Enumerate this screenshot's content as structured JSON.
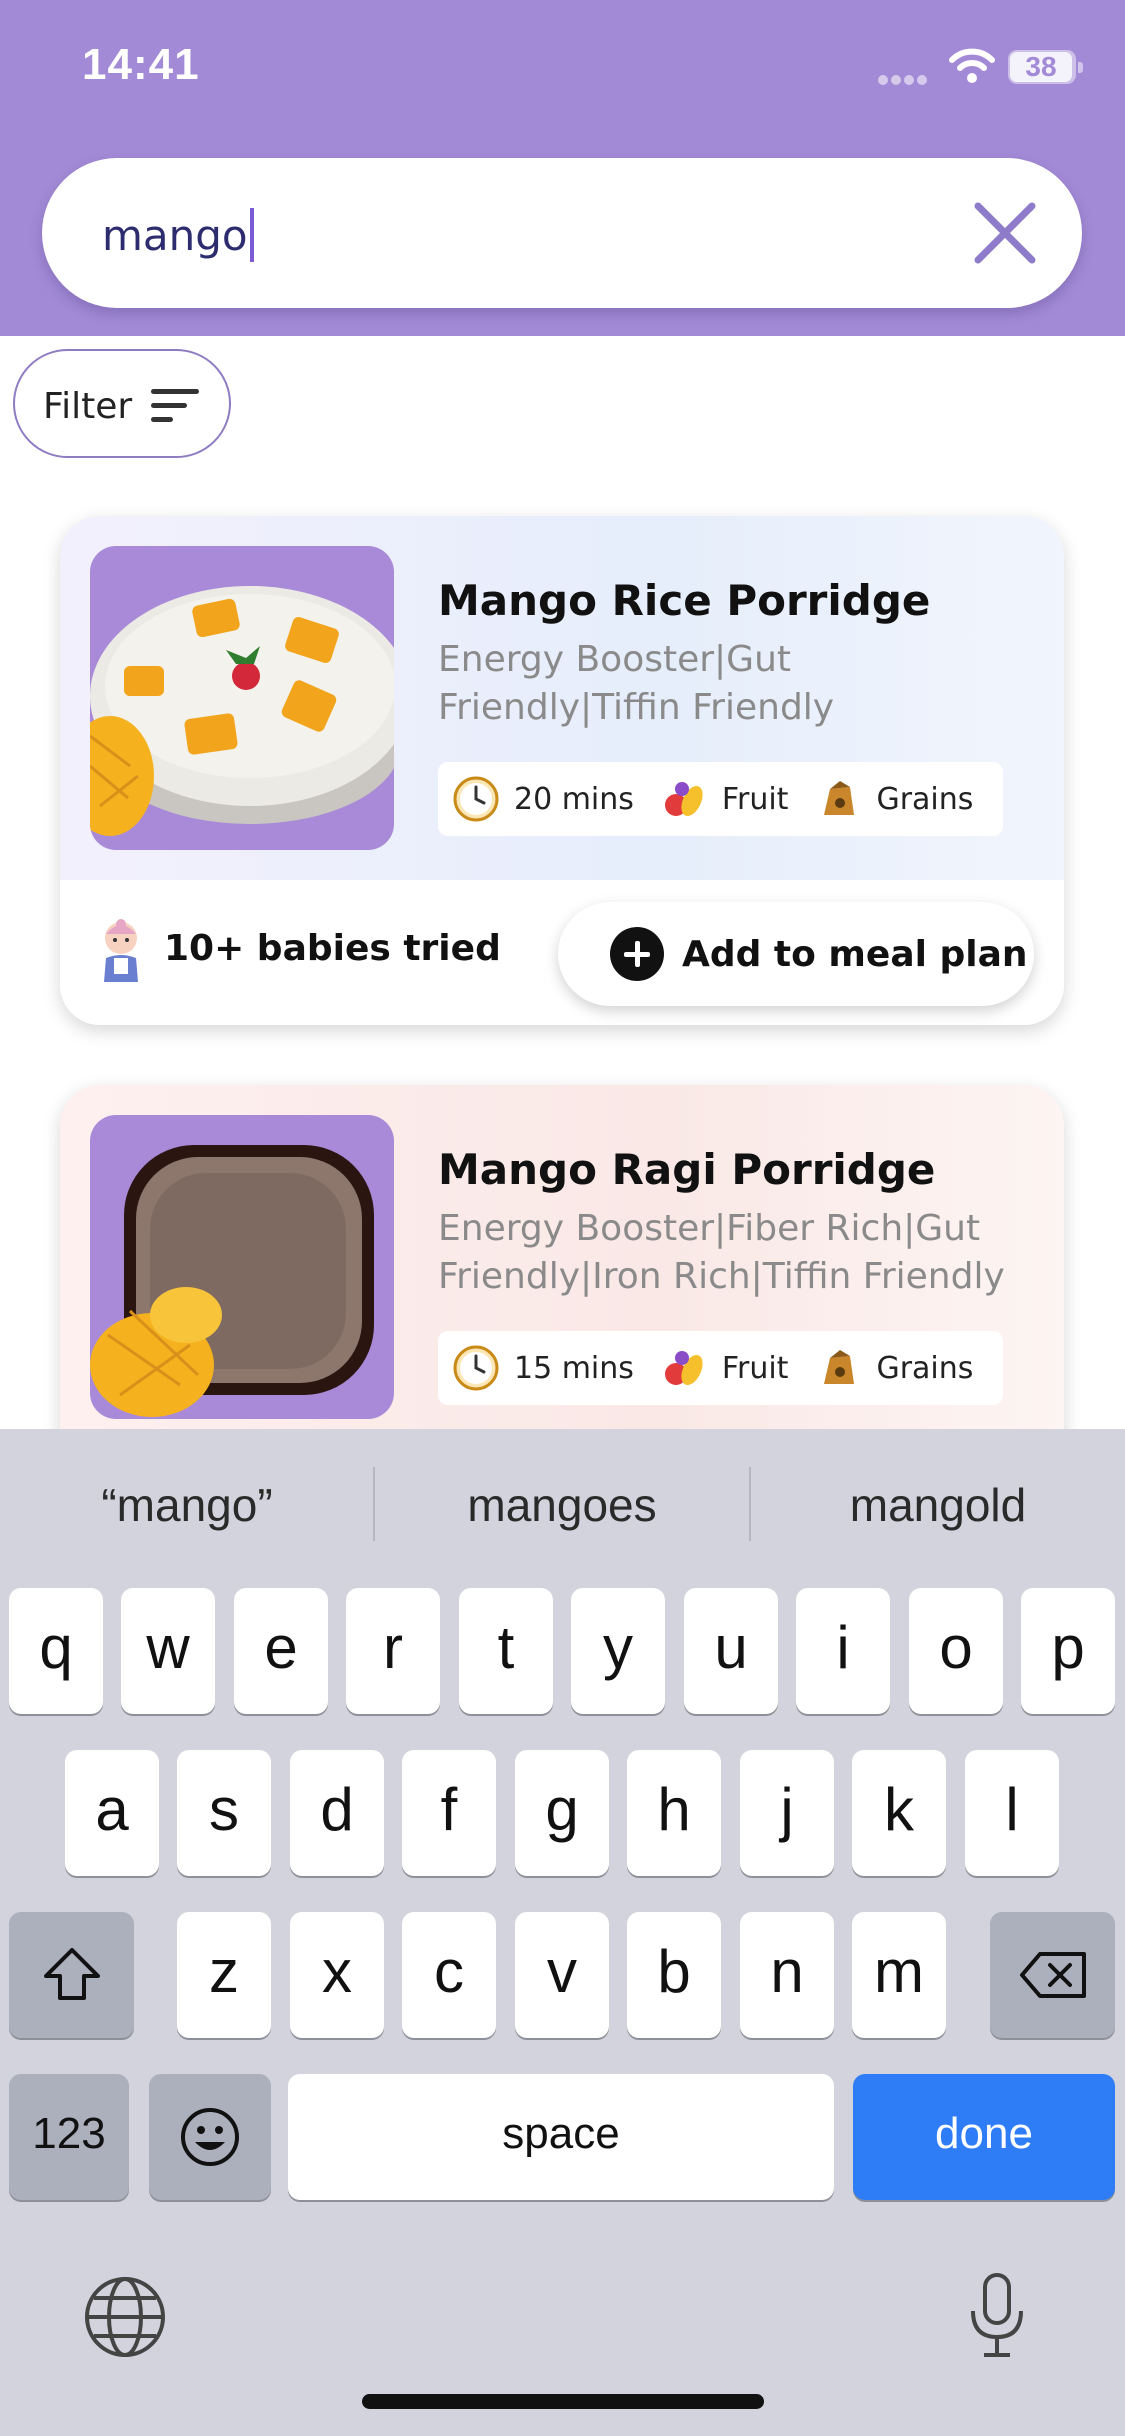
{
  "status_bar": {
    "time": "14:41",
    "battery": "38"
  },
  "search": {
    "value": "mango"
  },
  "filter": {
    "label": "Filter"
  },
  "recipes": [
    {
      "title": "Mango Rice Porridge",
      "tags": "Energy Booster|Gut Friendly|Tiffin Friendly",
      "time": "20 mins",
      "category1": "Fruit",
      "category2": "Grains",
      "tried": "10+ babies tried",
      "add_label": "Add to meal plan"
    },
    {
      "title": "Mango Ragi Porridge",
      "tags": "Energy Booster|Fiber Rich|Gut Friendly|Iron Rich|Tiffin Friendly",
      "time": "15 mins",
      "category1": "Fruit",
      "category2": "Grains"
    }
  ],
  "keyboard": {
    "suggestions": [
      "“mango”",
      "mangoes",
      "mangold"
    ],
    "row1": [
      "q",
      "w",
      "e",
      "r",
      "t",
      "y",
      "u",
      "i",
      "o",
      "p"
    ],
    "row2": [
      "a",
      "s",
      "d",
      "f",
      "g",
      "h",
      "j",
      "k",
      "l"
    ],
    "row3": [
      "z",
      "x",
      "c",
      "v",
      "b",
      "n",
      "m"
    ],
    "numbers_key": "123",
    "space_key": "space",
    "done_key": "done"
  },
  "colors": {
    "header": "#a28ad6",
    "accent": "#2f7df6",
    "clear_icon": "#8e7bc9"
  }
}
